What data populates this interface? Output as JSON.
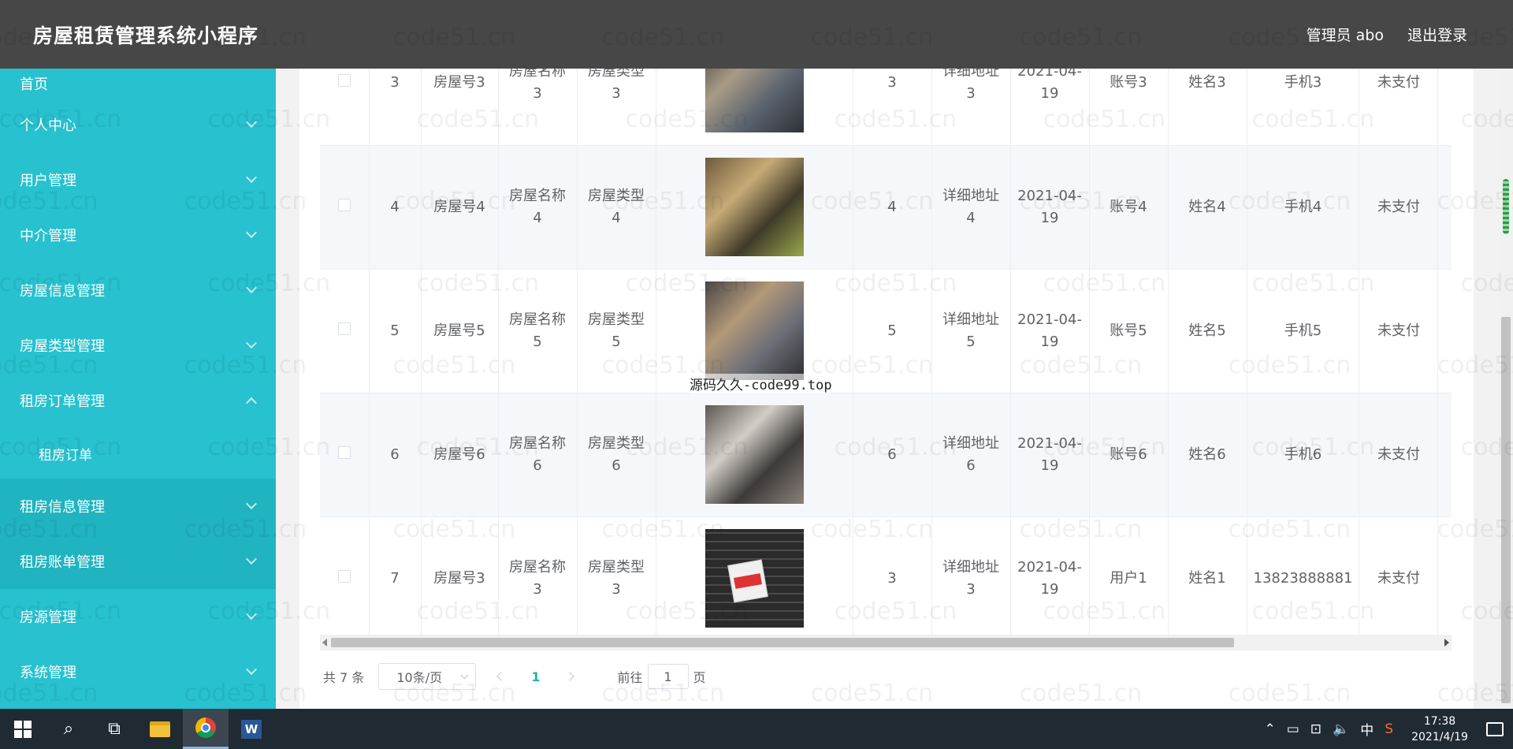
{
  "header": {
    "title": "房屋租赁管理系统小程序",
    "user": "管理员 abo",
    "logout": "退出登录"
  },
  "sidebar": {
    "items": [
      {
        "label": "首页"
      },
      {
        "label": "个人中心"
      },
      {
        "label": "用户管理"
      },
      {
        "label": "中介管理"
      },
      {
        "label": "房屋信息管理"
      },
      {
        "label": "房屋类型管理"
      },
      {
        "label": "租房订单管理"
      },
      {
        "label": "租房信息管理"
      },
      {
        "label": "租房账单管理"
      },
      {
        "label": "房源管理"
      },
      {
        "label": "系统管理"
      }
    ],
    "submenu": {
      "label": "租房订单"
    }
  },
  "table": {
    "rows": [
      {
        "index": "3",
        "house_no": "房屋号3",
        "house_name": "房屋名称3",
        "house_type": "房屋类型3",
        "qty": "3",
        "address": "详细地址3",
        "date": "2021-04-19",
        "account": "账号3",
        "name": "姓名3",
        "phone": "手机3",
        "status": "未支付"
      },
      {
        "index": "4",
        "house_no": "房屋号4",
        "house_name": "房屋名称4",
        "house_type": "房屋类型4",
        "qty": "4",
        "address": "详细地址4",
        "date": "2021-04-19",
        "account": "账号4",
        "name": "姓名4",
        "phone": "手机4",
        "status": "未支付"
      },
      {
        "index": "5",
        "house_no": "房屋号5",
        "house_name": "房屋名称5",
        "house_type": "房屋类型5",
        "qty": "5",
        "address": "详细地址5",
        "date": "2021-04-19",
        "account": "账号5",
        "name": "姓名5",
        "phone": "手机5",
        "status": "未支付"
      },
      {
        "index": "6",
        "house_no": "房屋号6",
        "house_name": "房屋名称6",
        "house_type": "房屋类型6",
        "qty": "6",
        "address": "详细地址6",
        "date": "2021-04-19",
        "account": "账号6",
        "name": "姓名6",
        "phone": "手机6",
        "status": "未支付"
      },
      {
        "index": "7",
        "house_no": "房屋号3",
        "house_name": "房屋名称3",
        "house_type": "房屋类型3",
        "qty": "3",
        "address": "详细地址3",
        "date": "2021-04-19",
        "account": "用户1",
        "name": "姓名1",
        "phone": "13823888881",
        "status": "未支付"
      }
    ]
  },
  "pager": {
    "total": "共 7 条",
    "page_size": "10条/页",
    "current": "1",
    "goto_label": "前往",
    "goto_value": "1",
    "page_unit": "页"
  },
  "watermark": "源码久久-code99.top",
  "bg_watermark": "code51.cn",
  "taskbar": {
    "time": "17:38",
    "date": "2021/4/19",
    "ime": "中"
  },
  "colors": {
    "sidebar": "#27c1cf",
    "header": "#474747",
    "accent": "#1fb6a8"
  }
}
